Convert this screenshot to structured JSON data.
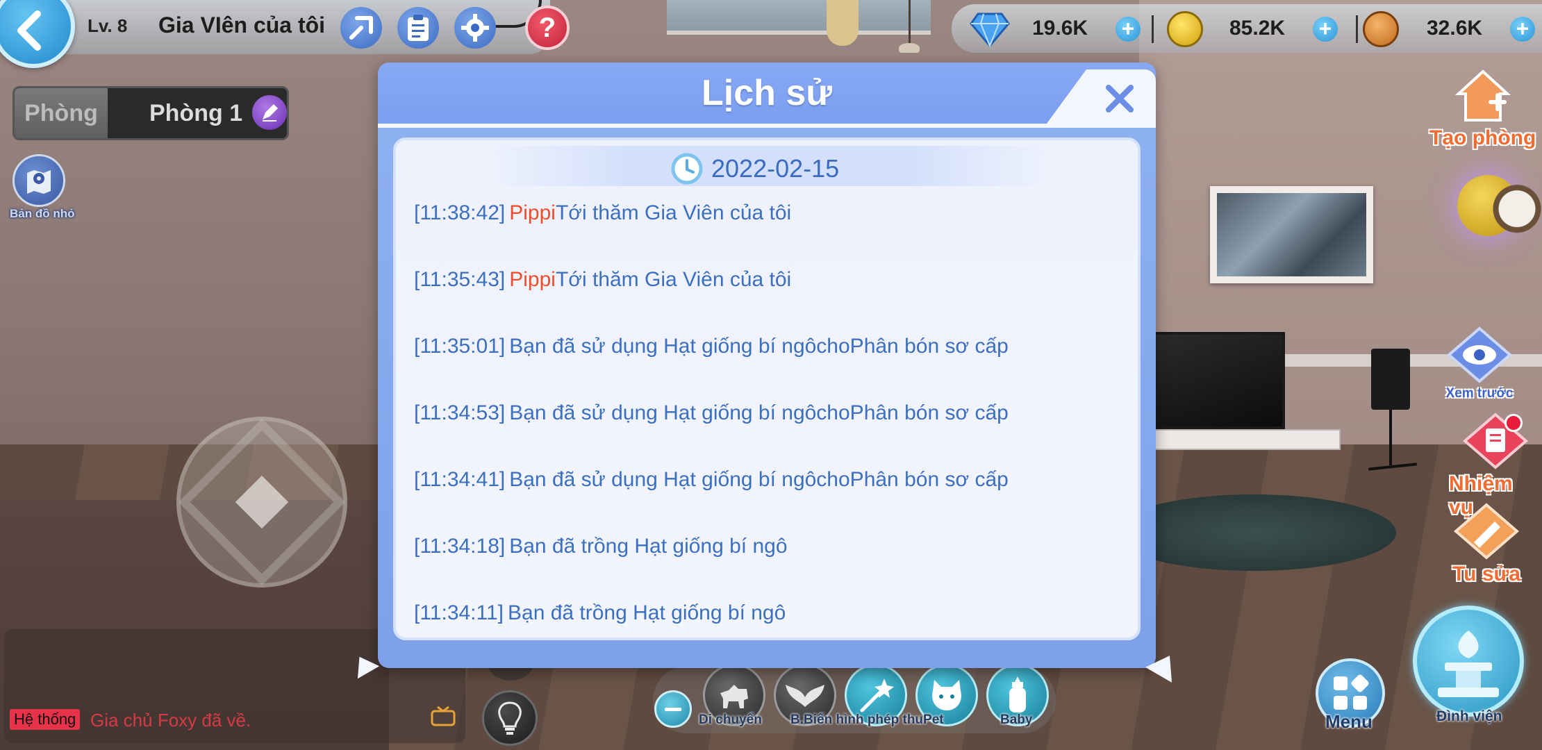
{
  "hud": {
    "level": "Lv. 8",
    "garden_name": "Gia VIên của tôi"
  },
  "rooms": {
    "tab_a": "Phòng",
    "tab_b": "Phòng 1"
  },
  "minimap": {
    "label": "Bản đồ nhỏ"
  },
  "currency": {
    "gems": "19.6K",
    "coins": "85.2K",
    "tokens": "32.6K"
  },
  "side_buttons": {
    "create_room": "Tạo phòng",
    "preview": "Xem trước",
    "quest": "Nhiệm vụ",
    "fix": "Tu sửa",
    "menu": "Menu",
    "garden": "Đình viện"
  },
  "chat": {
    "tag": "Hệ thống",
    "message": "Gia chủ Foxy đã về."
  },
  "actions": {
    "move": "Di chuyển",
    "transform": "B.Biến hình phép thu",
    "pet": "Pet",
    "baby": "Baby"
  },
  "modal": {
    "title": "Lịch sử",
    "date": "2022-02-15",
    "entries": [
      {
        "time": "[11:38:42]",
        "name": "Pippi",
        "text": "Tới thăm Gia Viên của tôi"
      },
      {
        "time": "[11:35:43]",
        "name": "Pippi",
        "text": "Tới thăm Gia Viên của tôi"
      },
      {
        "time": "[11:35:01]",
        "name": "",
        "text": "Bạn đã sử dụng Hạt giống bí ngôchoPhân bón sơ cấp"
      },
      {
        "time": "[11:34:53]",
        "name": "",
        "text": "Bạn đã sử dụng Hạt giống bí ngôchoPhân bón sơ cấp"
      },
      {
        "time": "[11:34:41]",
        "name": "",
        "text": "Bạn đã sử dụng Hạt giống bí ngôchoPhân bón sơ cấp"
      },
      {
        "time": "[11:34:18]",
        "name": "",
        "text": "Bạn đã trồng Hạt giống bí ngô"
      },
      {
        "time": "[11:34:11]",
        "name": "",
        "text": "Bạn đã trồng Hạt giống bí ngô"
      }
    ]
  },
  "colors": {
    "modal_header": "#7b9ef0",
    "log_text": "#3b6fbf",
    "log_name": "#ef4e2c",
    "side_label": "#ef6c33",
    "chat_message": "#d73a44"
  },
  "icons": {
    "back": "chevron-left-icon",
    "expand": "expand-icon",
    "clipboard": "clipboard-icon",
    "settings": "gear-icon",
    "help": "question-icon",
    "edit": "pen-icon",
    "map": "map-pin-icon",
    "gem": "diamond-icon",
    "coin": "coin-icon",
    "token": "token-icon",
    "close": "close-icon",
    "clock": "clock-icon"
  }
}
